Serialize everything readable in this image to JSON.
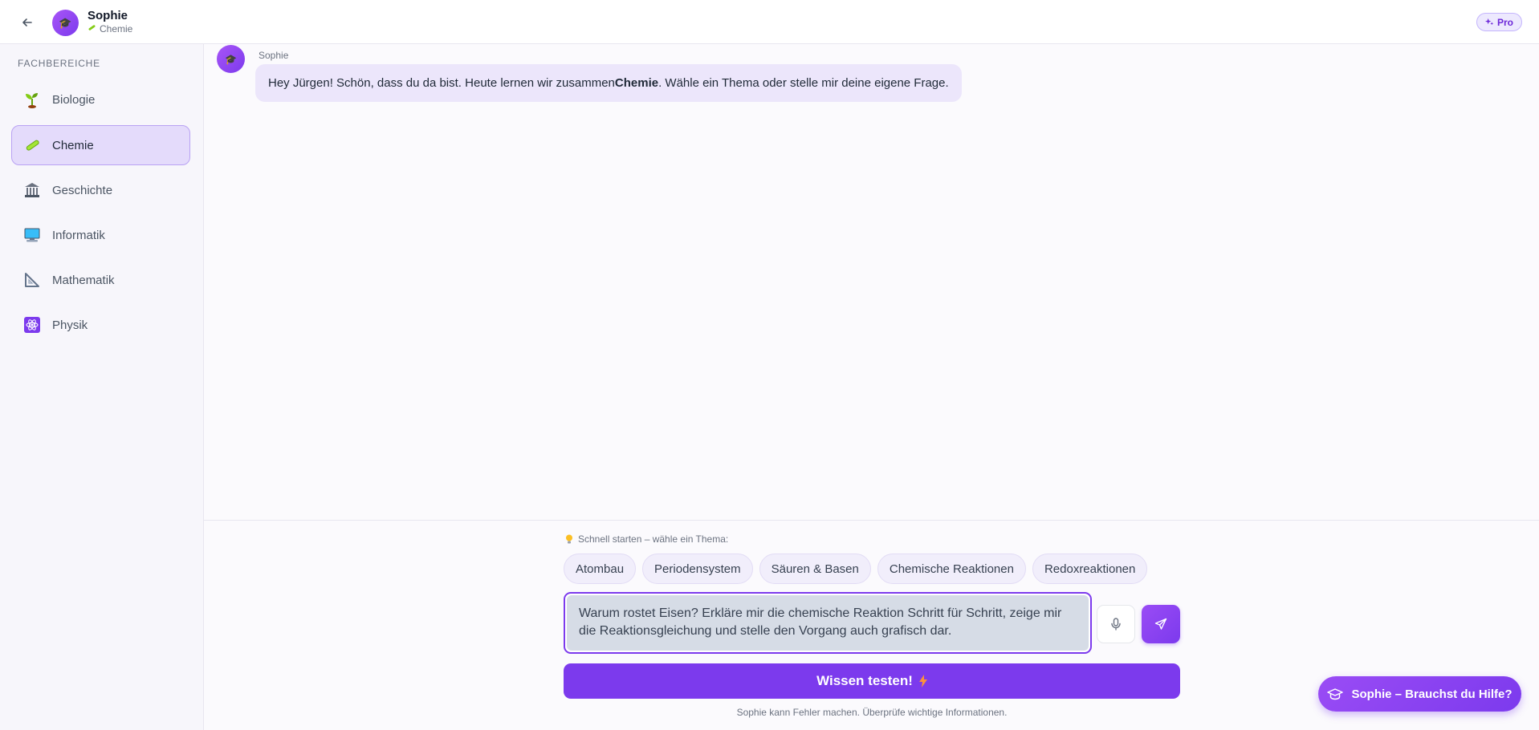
{
  "header": {
    "name": "Sophie",
    "subject": "Chemie",
    "pro_label": "Pro"
  },
  "sidebar": {
    "title": "FACHBEREICHE",
    "items": [
      {
        "label": "Biologie",
        "icon": "seedling-icon",
        "active": false
      },
      {
        "label": "Chemie",
        "icon": "test-tube-icon",
        "active": true
      },
      {
        "label": "Geschichte",
        "icon": "classical-building-icon",
        "active": false
      },
      {
        "label": "Informatik",
        "icon": "computer-icon",
        "active": false
      },
      {
        "label": "Mathematik",
        "icon": "triangle-ruler-icon",
        "active": false
      },
      {
        "label": "Physik",
        "icon": "atom-icon",
        "active": false
      }
    ]
  },
  "chat": {
    "sender": "Sophie",
    "message_pre": "Hey Jürgen! Schön, dass du da bist. Heute lernen wir zusammen ",
    "message_bold": "Chemie",
    "message_post": ". Wähle ein Thema oder stelle mir deine eigene Frage."
  },
  "composer": {
    "quick_label": "Schnell starten – wähle ein Thema:",
    "chips": [
      "Atombau",
      "Periodensystem",
      "Säuren & Basen",
      "Chemische Reaktionen",
      "Redoxreaktionen"
    ],
    "input_value": "Warum rostet Eisen? Erkläre mir die chemische Reaktion Schritt für Schritt, zeige mir die Reaktionsgleichung und stelle den Vorgang auch grafisch dar.",
    "test_label": "Wissen testen!",
    "disclaimer": "Sophie kann Fehler machen. Überprüfe wichtige Informationen."
  },
  "help_button": {
    "label": "Sophie – Brauchst du Hilfe?"
  },
  "colors": {
    "accent": "#7c3aed",
    "accent_light": "#ede9fe",
    "active_bg": "#e4dbfb"
  }
}
